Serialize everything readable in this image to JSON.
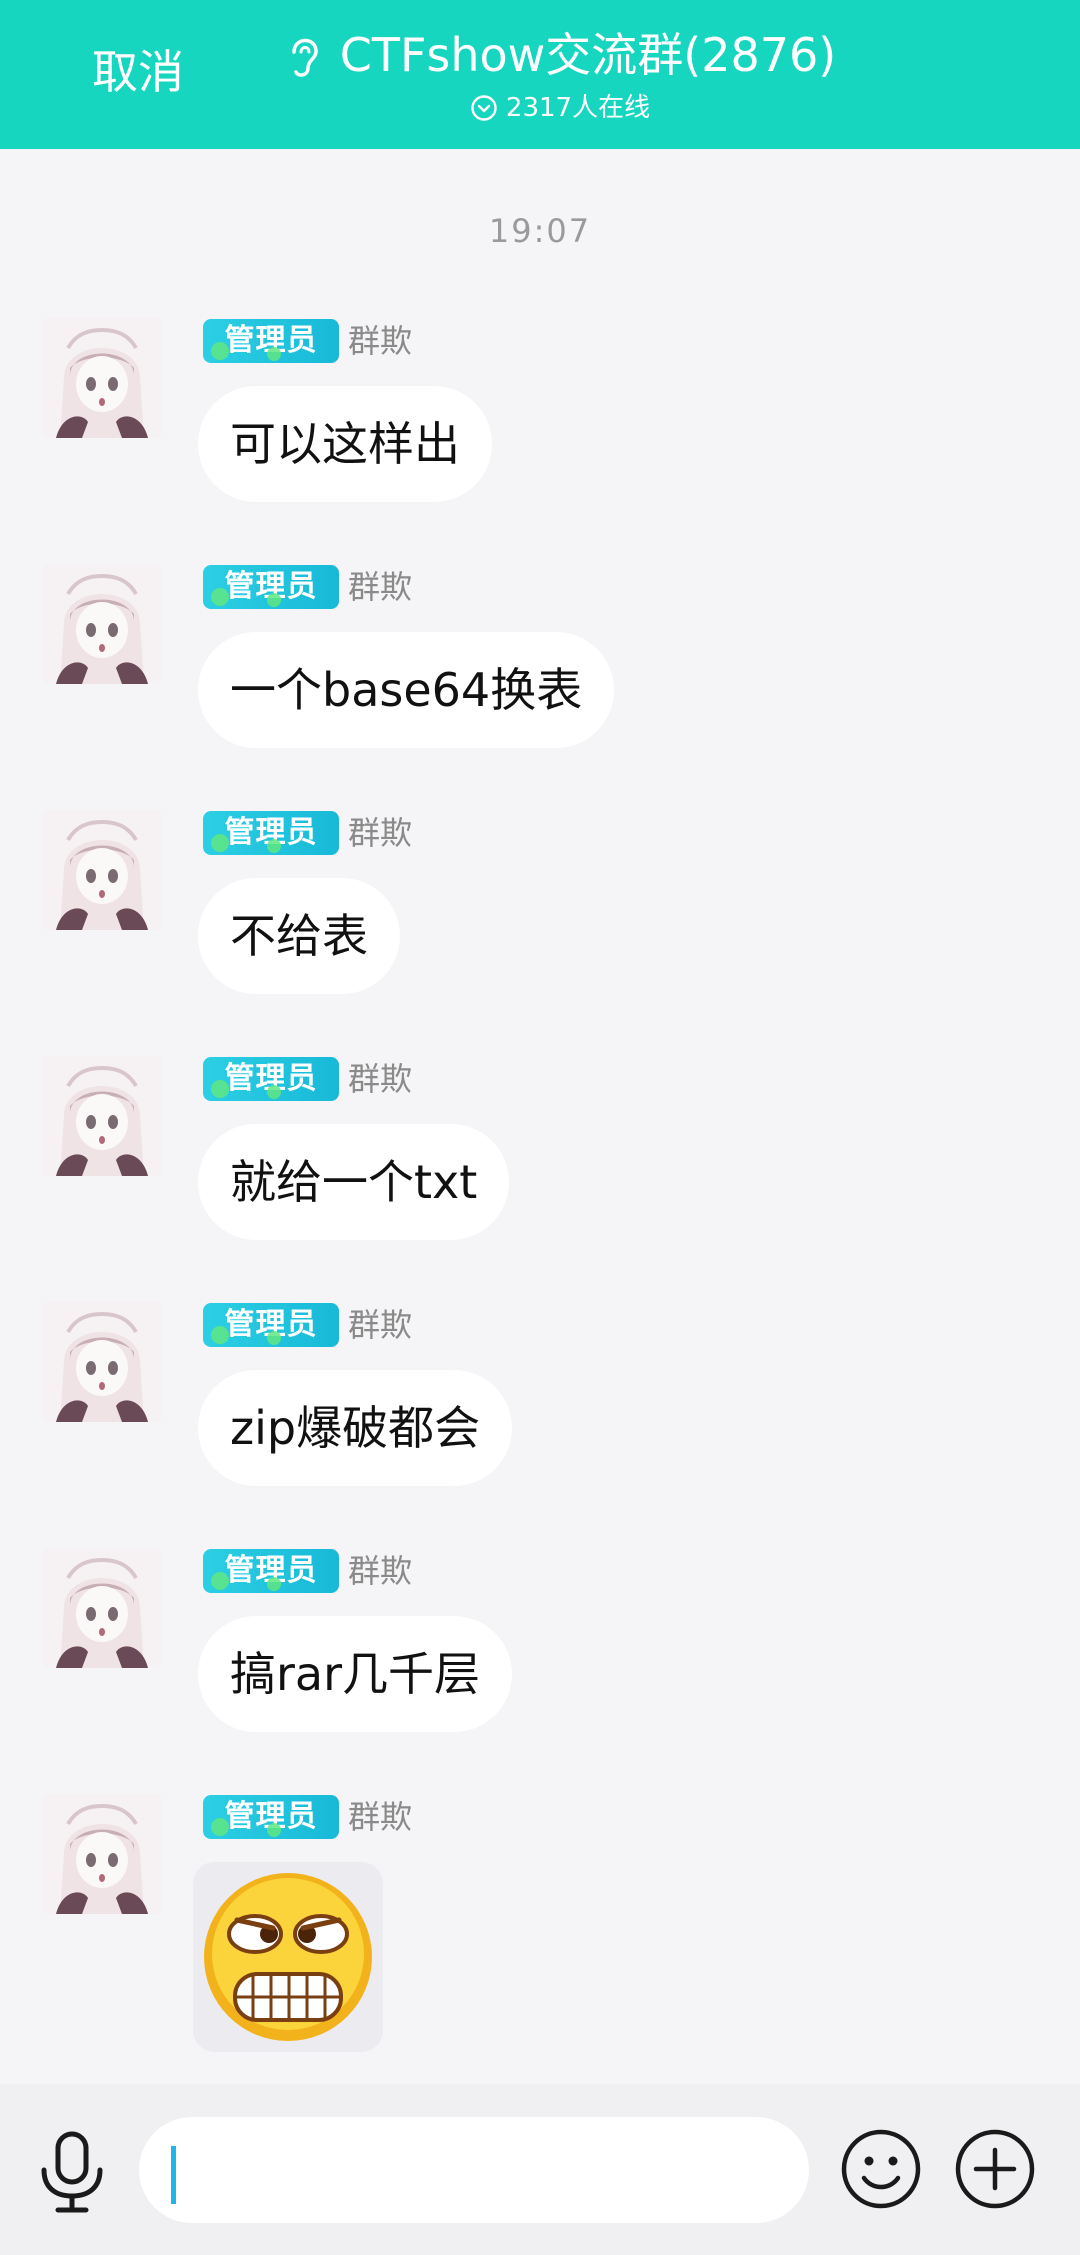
{
  "header": {
    "cancel_label": "取消",
    "title": "CTFshow交流群(2876)",
    "online_status": "2317人在线",
    "background_color": "#16d6c0"
  },
  "chat": {
    "timestamp": "19:07",
    "messages": [
      {
        "badge": "管理员",
        "sender": "群欺",
        "text": "可以这样出"
      },
      {
        "badge": "管理员",
        "sender": "群欺",
        "text": "一个base64换表"
      },
      {
        "badge": "管理员",
        "sender": "群欺",
        "text": "不给表"
      },
      {
        "badge": "管理员",
        "sender": "群欺",
        "text": "就给一个txt"
      },
      {
        "badge": "管理员",
        "sender": "群欺",
        "text": "zip爆破都会"
      },
      {
        "badge": "管理员",
        "sender": "群欺",
        "text": "搞rar几千层"
      },
      {
        "badge": "管理员",
        "sender": "群欺",
        "sticker": "grinning-emoji-sticker"
      }
    ]
  },
  "input_bar": {
    "voice_icon": "microphone-icon",
    "emoji_icon": "smiley-icon",
    "more_icon": "plus-circle-icon",
    "input_value": "",
    "caret_color": "#1fb6e8"
  }
}
